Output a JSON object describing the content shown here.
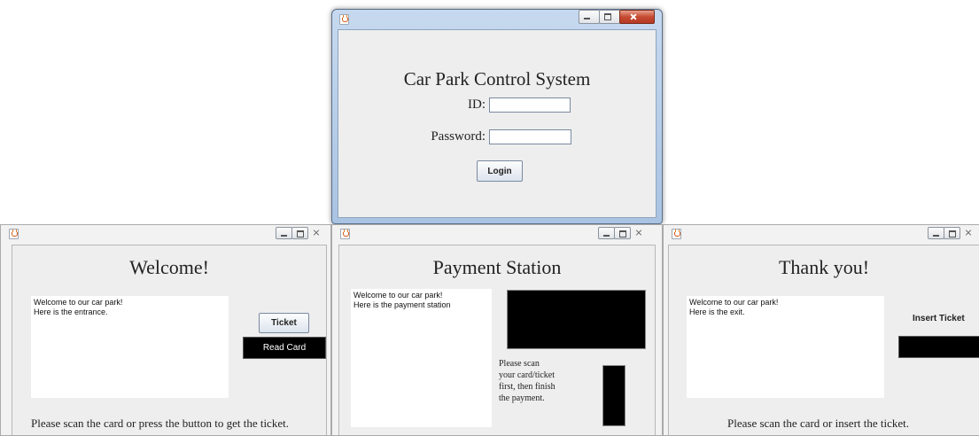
{
  "login": {
    "heading": "Car Park Control System",
    "id_label": "ID:",
    "id_value": "",
    "password_label": "Password:",
    "password_value": "",
    "login_button": "Login"
  },
  "entrance": {
    "heading": "Welcome!",
    "log_lines": [
      "Welcome to our car park!",
      "Here is the entrance."
    ],
    "ticket_button": "Ticket",
    "read_card_button": "Read Card",
    "instruction": "Please scan the card or press the button to get the ticket."
  },
  "payment": {
    "heading": "Payment Station",
    "log_lines": [
      "Welcome to our car park!",
      "Here is the payment station"
    ],
    "instruction_lines": [
      "Please scan",
      "your card/ticket",
      "first, then finish",
      "the payment."
    ]
  },
  "exit": {
    "heading": "Thank you!",
    "log_lines": [
      "Welcome to our car park!",
      "Here is the exit."
    ],
    "insert_ticket_button": "Insert Ticket",
    "instruction": "Please scan the card or insert the ticket."
  },
  "colors": {
    "panel_bg": "#eeeeee",
    "dark_widget": "#000000",
    "login_frame": "#b8cfe8"
  },
  "icons": [
    "java-icon",
    "minimize-icon",
    "maximize-icon",
    "close-icon"
  ]
}
